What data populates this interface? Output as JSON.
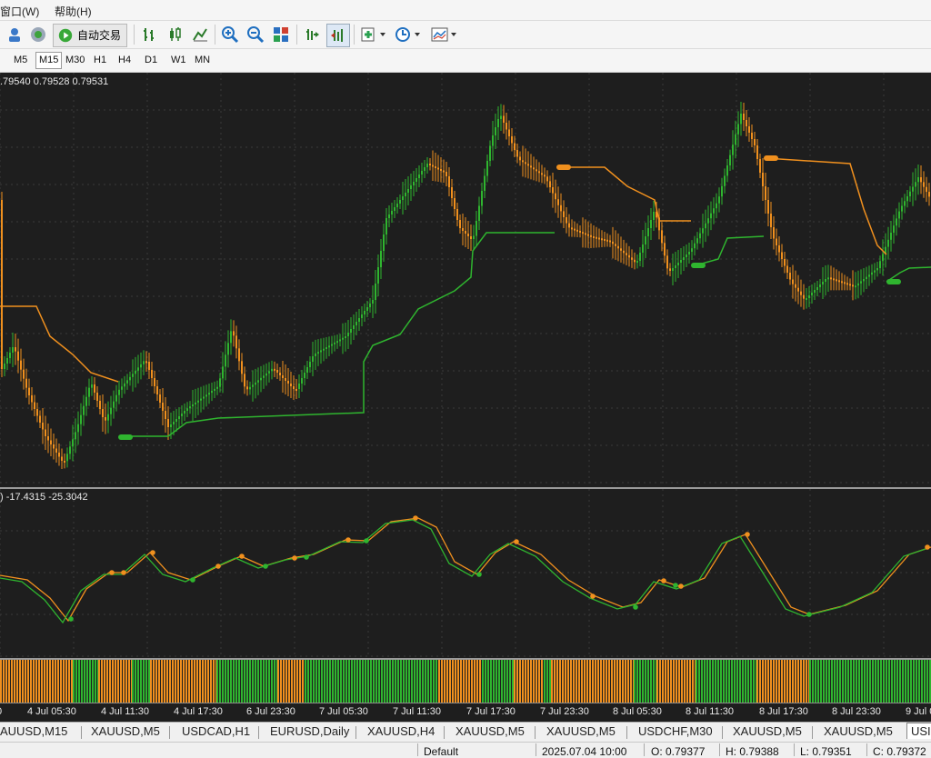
{
  "menu": {
    "window": "窗口(W)",
    "help": "帮助(H)"
  },
  "toolbar": {
    "auto_trade_label": "自动交易"
  },
  "timeframes": [
    {
      "label": "M5",
      "active": false
    },
    {
      "label": "M15",
      "active": true
    },
    {
      "label": "M30",
      "active": false
    },
    {
      "label": "H1",
      "active": false
    },
    {
      "label": "H4",
      "active": false
    },
    {
      "label": "D1",
      "active": false
    },
    {
      "label": "W1",
      "active": false
    },
    {
      "label": "MN",
      "active": false
    }
  ],
  "chart": {
    "ohlc_text": ".79540 0.79528 0.79531",
    "indicator_text": ") -17.4315 -25.3042",
    "bull_color": "#2fb52f",
    "bear_color": "#f0901e",
    "background": "#1e1e1e"
  },
  "xaxis_labels": [
    "4 Jul 05:30",
    "4 Jul 11:30",
    "4 Jul 17:30",
    "6 Jul 23:30",
    "7 Jul 05:30",
    "7 Jul 11:30",
    "7 Jul 17:30",
    "7 Jul 23:30",
    "8 Jul 05:30",
    "8 Jul 11:30",
    "8 Jul 17:30",
    "8 Jul 23:30",
    "9 Jul 0"
  ],
  "tabs": [
    {
      "label": "AUUSD,M15",
      "active": false
    },
    {
      "label": "XAUUSD,M5",
      "active": false
    },
    {
      "label": "USDCAD,H1",
      "active": false
    },
    {
      "label": "EURUSD,Daily",
      "active": false
    },
    {
      "label": "XAUUSD,H4",
      "active": false
    },
    {
      "label": "XAUUSD,M5",
      "active": false
    },
    {
      "label": "XAUUSD,M5",
      "active": false
    },
    {
      "label": "USDCHF,M30",
      "active": false
    },
    {
      "label": "XAUUSD,M5",
      "active": false
    },
    {
      "label": "XAUUSD,M5",
      "active": false
    },
    {
      "label": "USI",
      "active": true
    }
  ],
  "status": {
    "profile": "Default",
    "datetime": "2025.07.04 10:00",
    "open": "O: 0.79377",
    "high": "H: 0.79388",
    "low": "L: 0.79351",
    "close": "C: 0.79372"
  }
}
